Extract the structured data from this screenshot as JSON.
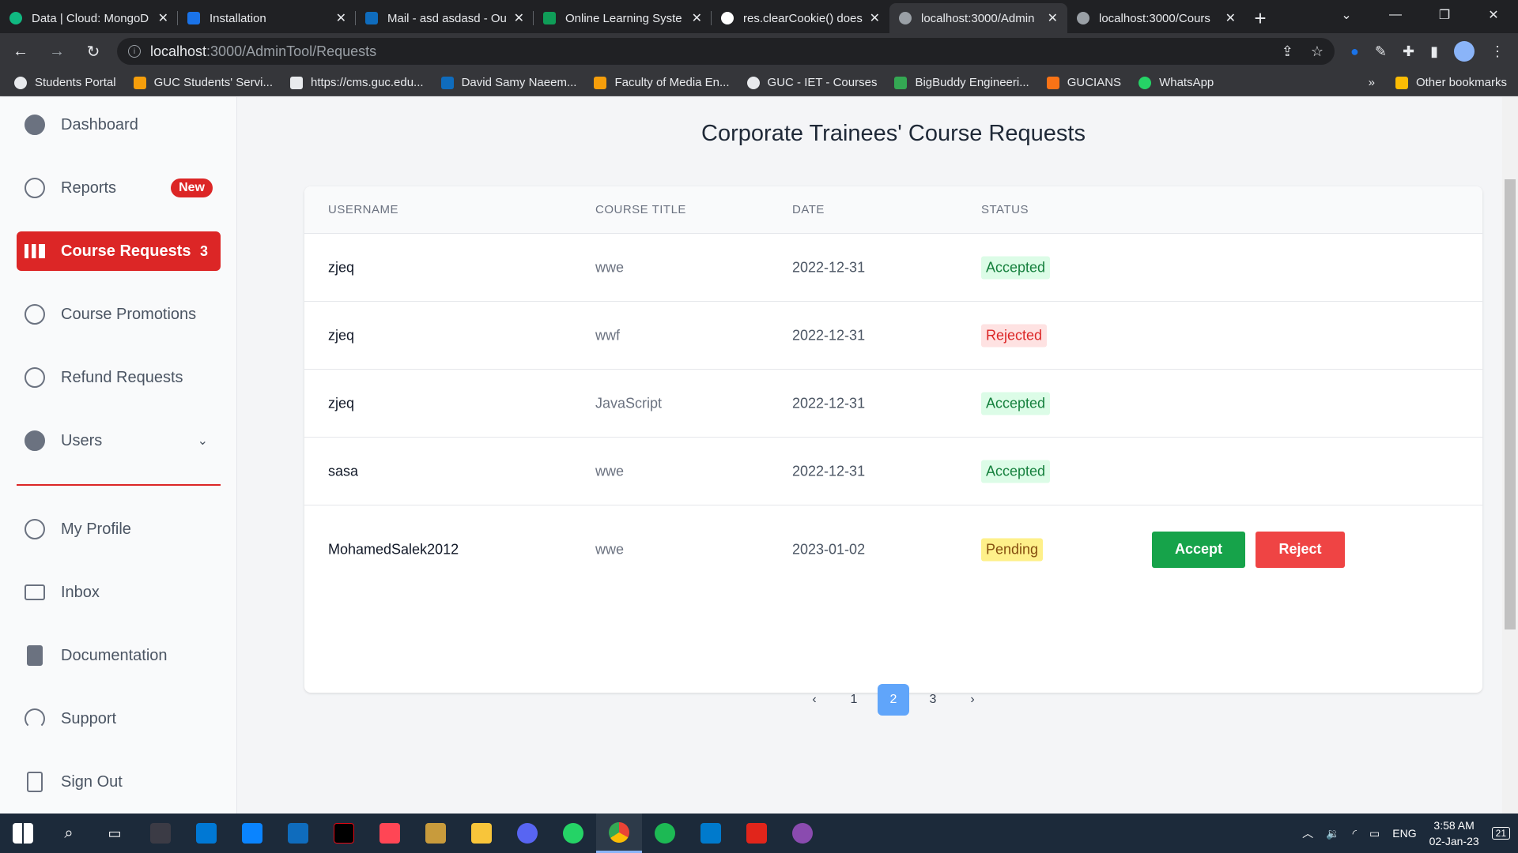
{
  "browser": {
    "tabs": [
      {
        "title": "Data | Cloud: MongoD",
        "color": "#10b981"
      },
      {
        "title": "Installation",
        "color": "#1a73e8"
      },
      {
        "title": "Mail - asd asdasd - Ou",
        "color": "#0f6cbd"
      },
      {
        "title": "Online Learning Syste",
        "color": "#0f9d58"
      },
      {
        "title": "res.clearCookie() does",
        "color": "#ffffff"
      },
      {
        "title": "localhost:3000/Admin",
        "color": "#9aa0a6"
      },
      {
        "title": "localhost:3000/Cours",
        "color": "#9aa0a6"
      }
    ],
    "url_host": "localhost",
    "url_path": ":3000/AdminTool/Requests",
    "bookmarks": [
      "Students Portal",
      "GUC Students' Servi...",
      "https://cms.guc.edu...",
      "David Samy Naeem...",
      "Faculty of Media En...",
      "GUC - IET - Courses",
      "BigBuddy Engineeri...",
      "GUCIANS",
      "WhatsApp"
    ],
    "other_bookmarks": "Other bookmarks"
  },
  "sidebar": {
    "items": [
      {
        "label": "Dashboard"
      },
      {
        "label": "Reports",
        "badge": "New"
      },
      {
        "label": "Course Requests",
        "badge": "3"
      },
      {
        "label": "Course Promotions"
      },
      {
        "label": "Refund Requests"
      },
      {
        "label": "Users"
      },
      {
        "label": "My Profile"
      },
      {
        "label": "Inbox"
      },
      {
        "label": "Documentation"
      },
      {
        "label": "Support"
      },
      {
        "label": "Sign Out"
      }
    ]
  },
  "main": {
    "title": "Corporate Trainees' Course Requests",
    "columns": [
      "USERNAME",
      "COURSE TITLE",
      "DATE",
      "STATUS"
    ],
    "rows": [
      {
        "username": "zjeq",
        "course": "wwe",
        "date": "2022-12-31",
        "status": "Accepted"
      },
      {
        "username": "zjeq",
        "course": "wwf",
        "date": "2022-12-31",
        "status": "Rejected"
      },
      {
        "username": "zjeq",
        "course": "JavaScript",
        "date": "2022-12-31",
        "status": "Accepted"
      },
      {
        "username": "sasa",
        "course": "wwe",
        "date": "2022-12-31",
        "status": "Accepted"
      },
      {
        "username": "MohamedSalek2012",
        "course": "wwe",
        "date": "2023-01-02",
        "status": "Pending"
      }
    ],
    "accept_label": "Accept",
    "reject_label": "Reject",
    "pagination": {
      "prev": "‹",
      "pages": [
        "1",
        "2",
        "3"
      ],
      "current": "2",
      "next": "›"
    }
  },
  "taskbar": {
    "language": "ENG",
    "time": "3:58 AM",
    "date": "02-Jan-23",
    "notifications": "21"
  }
}
